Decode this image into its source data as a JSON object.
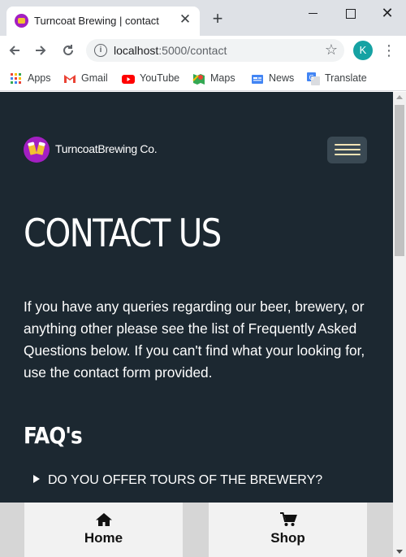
{
  "browser": {
    "tab_title": "Turncoat Brewing | contact",
    "tab_close": "✕",
    "new_tab": "+",
    "url_host": "localhost",
    "url_rest": ":5000/contact",
    "profile_initial": "K",
    "bookmarks": [
      "Apps",
      "Gmail",
      "YouTube",
      "Maps",
      "News",
      "Translate"
    ]
  },
  "header": {
    "brand_name": "TurncoatBrewing Co."
  },
  "main": {
    "title": "CONTACT US",
    "intro": "If you have any queries regarding our beer, brewery, or anything other please see the list of Frequently Asked Questions below. If you can't find what your looking for, use the contact form provided.",
    "faq_title": "FAQ's",
    "faq_items": [
      "DO YOU OFFER TOURS OF THE BREWERY?"
    ]
  },
  "bottom_nav": {
    "home_label": "Home",
    "shop_label": "Shop"
  },
  "colors": {
    "page_bg": "#1c2831",
    "accent_purple": "#a31fc2",
    "accent_gold": "#f2c230",
    "nav_bar_bg": "#f2f2f2"
  },
  "icons": {
    "home": "home-icon",
    "shop": "cart-icon",
    "menu": "hamburger-icon"
  }
}
